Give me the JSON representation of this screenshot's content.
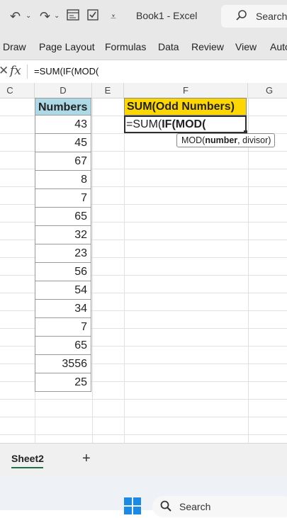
{
  "titlebar": {
    "title": "Book1  -  Excel",
    "search_label": "Search"
  },
  "ribbon": {
    "tabs": [
      "Draw",
      "Page Layout",
      "Formulas",
      "Data",
      "Review",
      "View",
      "Auto"
    ]
  },
  "formula_bar": {
    "fx_label": "fx",
    "content": "=SUM(IF(MOD("
  },
  "columns": [
    "C",
    "D",
    "E",
    "F",
    "G"
  ],
  "table": {
    "header": "Numbers",
    "values": [
      "43",
      "45",
      "67",
      "8",
      "7",
      "65",
      "32",
      "23",
      "56",
      "54",
      "34",
      "7",
      "65",
      "3556",
      "25"
    ]
  },
  "result": {
    "header": "SUM(Odd Numbers)",
    "editing_prefix": "=SUM(",
    "editing_bold": "IF(MOD("
  },
  "tooltip": {
    "func": "MOD(",
    "arg_current": "number",
    "rest": ", divisor)"
  },
  "sheets": {
    "active": "Sheet2",
    "add_label": "+"
  },
  "taskbar": {
    "search_label": "Search"
  },
  "colors": {
    "header_fill": "#add8e6",
    "result_fill": "#ffd700",
    "sheet_accent": "#1e7145"
  }
}
